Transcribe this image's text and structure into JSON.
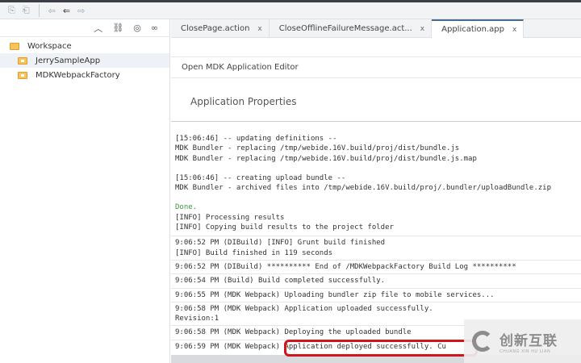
{
  "toolbar": {
    "icons": [
      "import-icon",
      "export-icon",
      "back-icon",
      "prev-icon",
      "next-icon"
    ]
  },
  "left_panel": {
    "tree": [
      {
        "label": "Workspace"
      },
      {
        "label": "JerrySampleApp"
      },
      {
        "label": "MDKWebpackFactory"
      }
    ]
  },
  "tabs": [
    {
      "label": "ClosePage.action"
    },
    {
      "label": "CloseOfflineFailureMessage.act..."
    },
    {
      "label": "Application.app"
    }
  ],
  "tab_close": "x",
  "editor": {
    "open_link": "Open MDK Application Editor",
    "section_title": "Application Properties"
  },
  "console": {
    "block1": [
      "[15:06:46] -- updating definitions --",
      "MDK Bundler - replacing /tmp/webide.16V.build/proj/dist/bundle.js",
      "MDK Bundler - replacing /tmp/webide.16V.build/proj/dist/bundle.js.map"
    ],
    "block2": [
      "[15:06:46] -- creating upload bundle --",
      "MDK Bundler - archived files into /tmp/webide.16V.build/proj/.bundler/uploadBundle.zip"
    ],
    "done": "Done.",
    "block3": [
      "[INFO] Processing results",
      "[INFO] Copying build results to the project folder"
    ],
    "entries": [
      [
        "9:06:52 PM (DIBuild) [INFO] Grunt build finished",
        "[INFO] Build finished in 119 seconds"
      ],
      [
        "9:06:52 PM (DIBuild) ********** End of /MDKWebpackFactory Build Log **********"
      ],
      [
        "9:06:54 PM (Build) Build completed successfully."
      ],
      [
        "9:06:55 PM (MDK Webpack) Uploading bundler zip file to mobile services..."
      ],
      [
        "9:06:58 PM (MDK Webpack) Application uploaded successfully.",
        "Revision:1"
      ],
      [
        "9:06:58 PM (MDK Webpack) Deploying the uploaded bundle"
      ],
      [
        "9:06:59 PM (MDK Webpack) Application deployed successfully. Cu"
      ]
    ]
  },
  "watermark": {
    "cn": "创新互联",
    "en": "CHUANG XIN HU LIAN"
  },
  "colors": {
    "highlight": "#d0141c",
    "done": "#3a9a3a"
  }
}
